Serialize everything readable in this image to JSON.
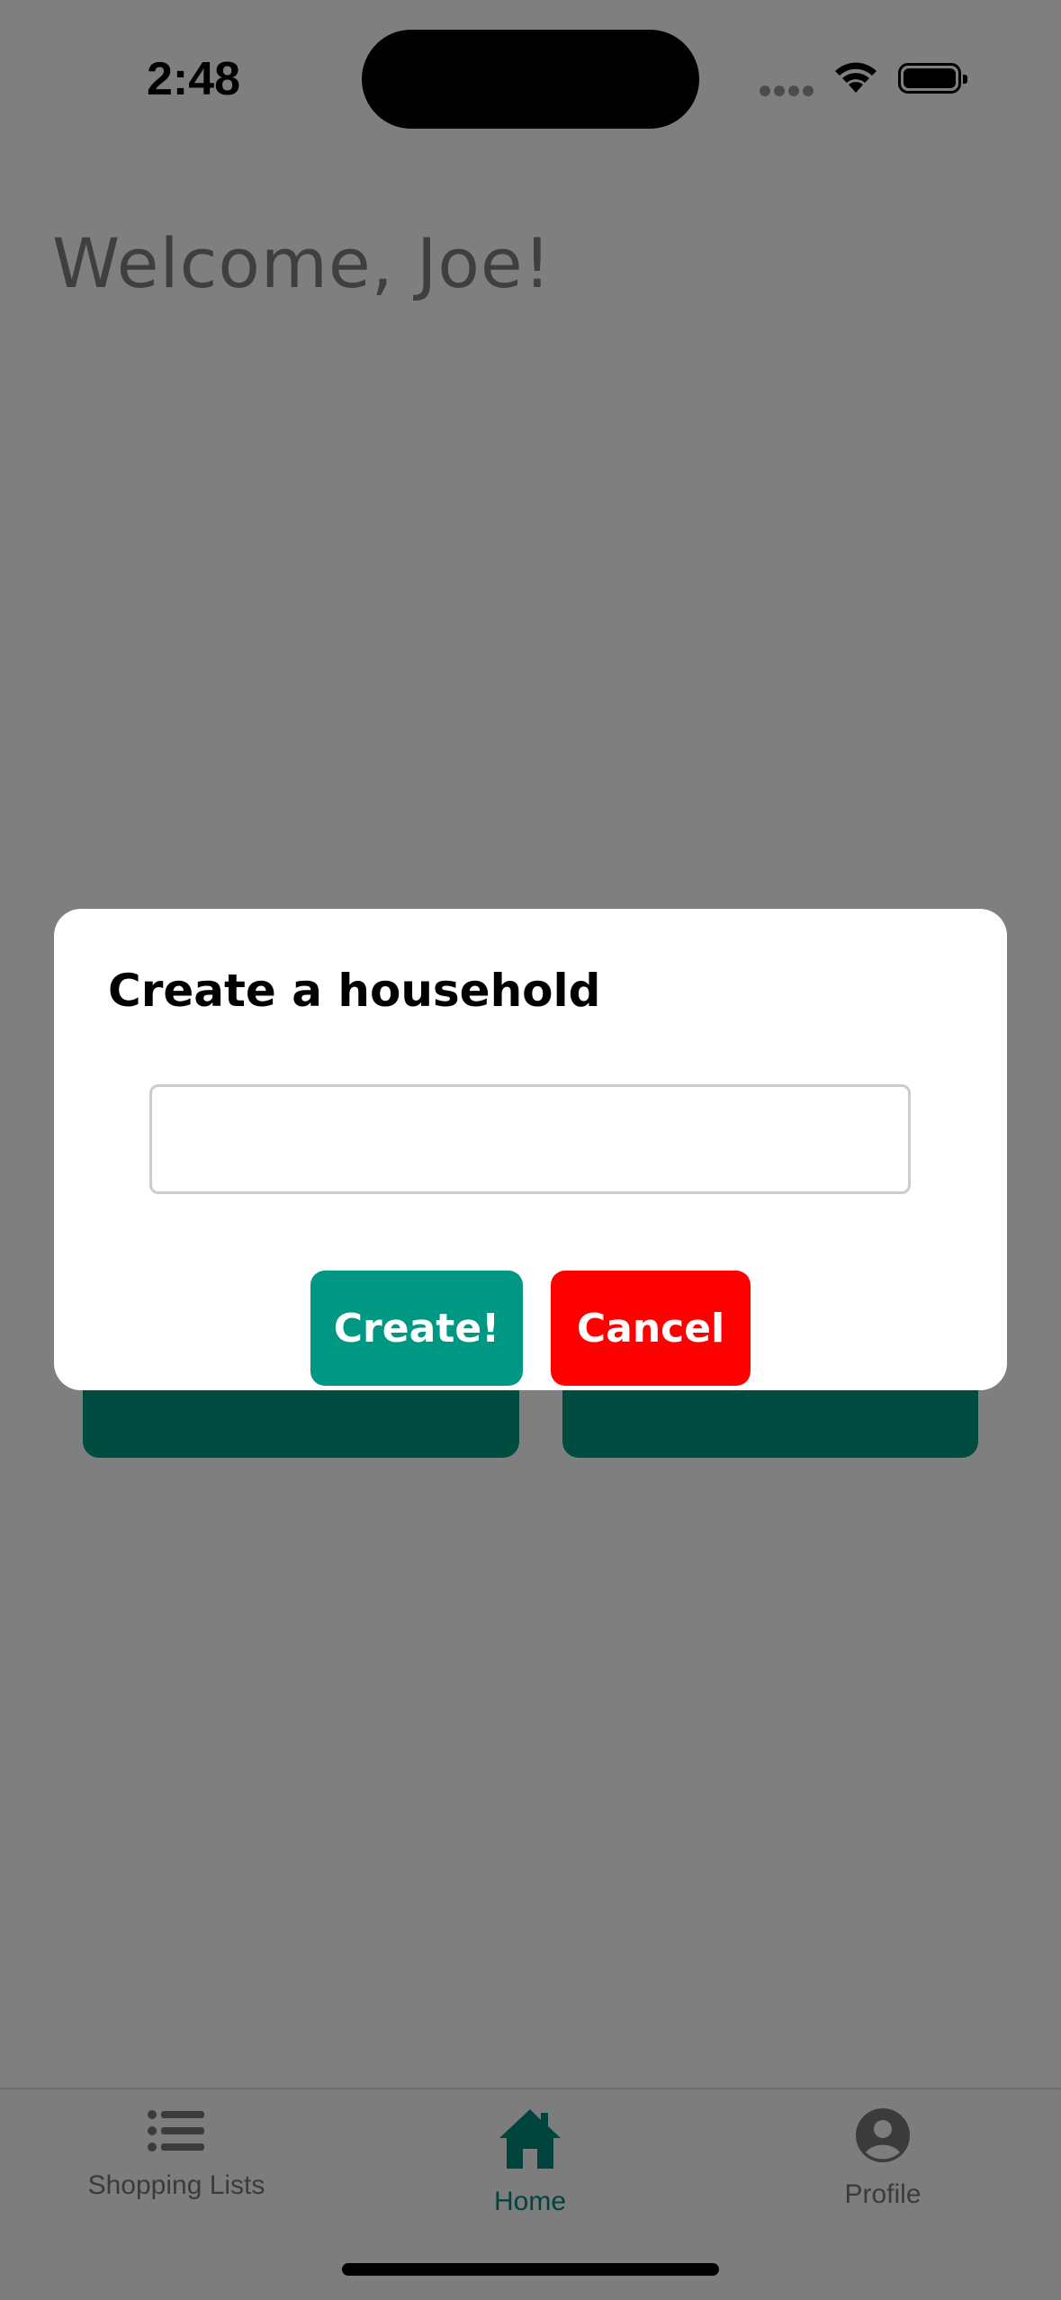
{
  "status_bar": {
    "time": "2:48"
  },
  "home": {
    "welcome": "Welcome, Joe!"
  },
  "dialog": {
    "title": "Create a household",
    "input_value": "",
    "create_label": "Create!",
    "cancel_label": "Cancel"
  },
  "tabs": [
    {
      "label": "Shopping Lists",
      "icon": "list-icon"
    },
    {
      "label": "Home",
      "icon": "home-icon",
      "active": true
    },
    {
      "label": "Profile",
      "icon": "profile-icon"
    }
  ],
  "colors": {
    "accent": "#009882",
    "danger": "#ff0000",
    "tab_active": "#00897b",
    "overlay": "rgba(0,0,0,0.5)"
  }
}
